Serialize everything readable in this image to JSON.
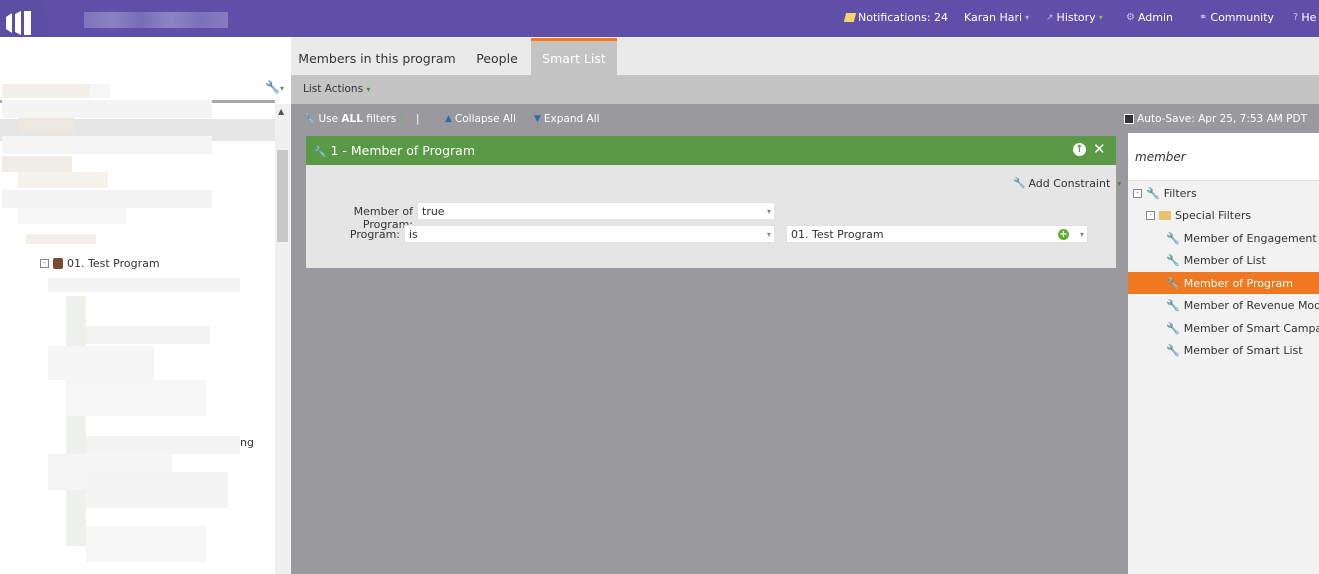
{
  "topbar": {
    "notifications": "Notifications: 24",
    "user": "Karan Hari",
    "history": "History",
    "admin": "Admin",
    "community": "Community",
    "help": "He"
  },
  "left": {
    "tree_item": "01. Test Program",
    "partial_text": "ng"
  },
  "tabs": [
    "Members in this program",
    "People",
    "Smart List"
  ],
  "list_actions": "List Actions",
  "toolbar": {
    "use_prefix": "Use ",
    "use_all": "ALL",
    "use_suffix": " filters",
    "separator": "|",
    "collapse": "Collapse All",
    "expand": "Expand All",
    "autosave": "Auto-Save: Apr 25, 7:53 AM PDT"
  },
  "filter": {
    "title": "1 - Member of Program",
    "add_constraint": "Add Constraint",
    "row1_label": "Member of Program:",
    "row1_value": "true",
    "row2_label": "Program:",
    "row2_operator": "is",
    "row2_value": "01. Test Program"
  },
  "right": {
    "search": "member",
    "filters": "Filters",
    "special_filters": "Special Filters",
    "items": [
      "Member of Engagement Pro",
      "Member of List",
      "Member of Program",
      "Member of Revenue Model",
      "Member of Smart Campaign",
      "Member of Smart List"
    ]
  }
}
